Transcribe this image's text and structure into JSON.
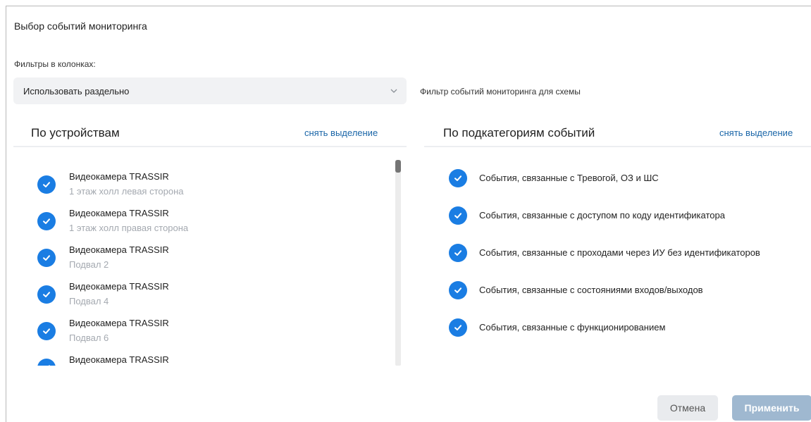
{
  "dialog": {
    "title": "Выбор событий мониторинга",
    "filters_label": "Фильтры в колонках:",
    "filter_mode": {
      "selected": "Использовать раздельно"
    },
    "scheme_filter_label": "Фильтр событий мониторинга для схемы"
  },
  "devices_panel": {
    "title": "По устройствам",
    "clear_label": "снять выделение",
    "items": [
      {
        "name": "Видеокамера TRASSIR",
        "location": "1 этаж холл левая сторона",
        "checked": true
      },
      {
        "name": "Видеокамера TRASSIR",
        "location": "1 этаж холл правая сторона",
        "checked": true
      },
      {
        "name": "Видеокамера TRASSIR",
        "location": "Подвал 2",
        "checked": true
      },
      {
        "name": "Видеокамера TRASSIR",
        "location": "Подвал 4",
        "checked": true
      },
      {
        "name": "Видеокамера TRASSIR",
        "location": "Подвал 6",
        "checked": true
      },
      {
        "name": "Видеокамера TRASSIR",
        "location": "",
        "checked": true
      }
    ]
  },
  "subcategories_panel": {
    "title": "По подкатегориям событий",
    "clear_label": "снять выделение",
    "items": [
      {
        "label": "События, связанные с Тревогой, ОЗ и ШС",
        "checked": true
      },
      {
        "label": "События, связанные с доступом по коду идентификатора",
        "checked": true
      },
      {
        "label": "События, связанные с проходами через ИУ без идентификаторов",
        "checked": true
      },
      {
        "label": "События, связанные с состояниями входов/выходов",
        "checked": true
      },
      {
        "label": "События, связанные с функционированием",
        "checked": true
      }
    ]
  },
  "buttons": {
    "cancel": "Отмена",
    "apply": "Применить"
  },
  "colors": {
    "accent": "#1a7de3",
    "link": "#1a66a8",
    "apply_disabled": "#9fb8d0"
  }
}
